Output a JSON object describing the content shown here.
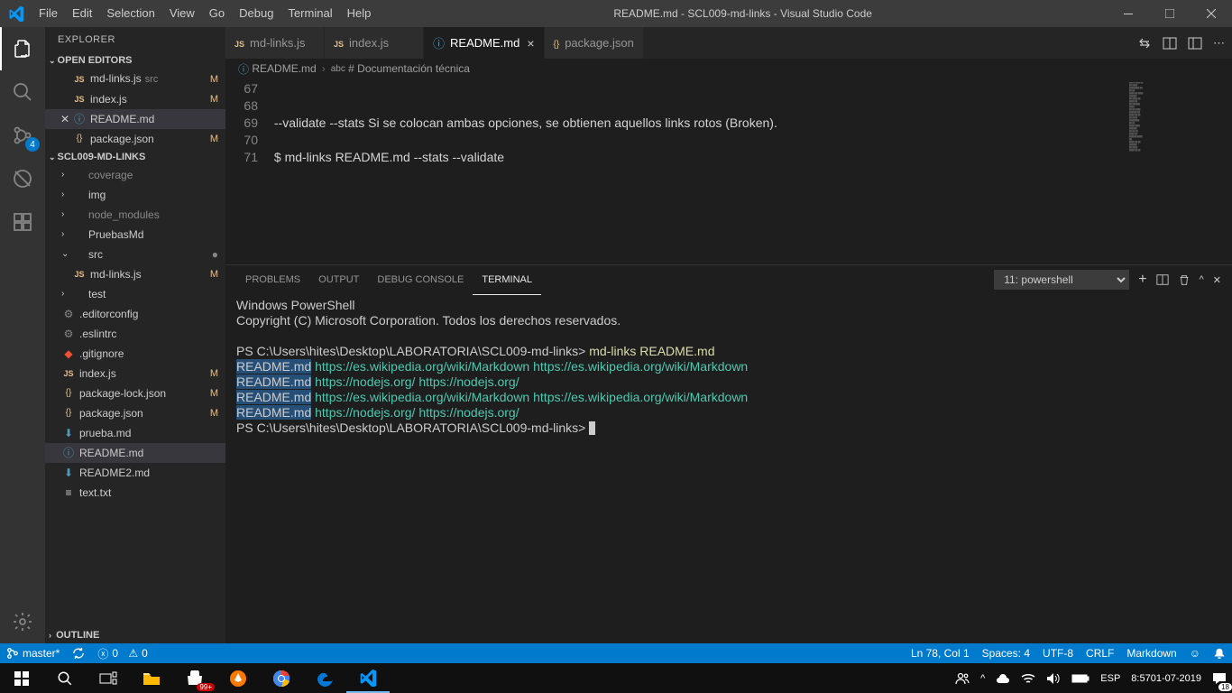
{
  "window": {
    "title": "README.md - SCL009-md-links - Visual Studio Code"
  },
  "menu": {
    "file": "File",
    "edit": "Edit",
    "selection": "Selection",
    "view": "View",
    "go": "Go",
    "debug": "Debug",
    "terminal": "Terminal",
    "help": "Help"
  },
  "activity": {
    "scm_badge": "4"
  },
  "sidebar": {
    "title": "EXPLORER",
    "sections": {
      "open_editors": "OPEN EDITORS",
      "workspace": "SCL009-MD-LINKS",
      "outline": "OUTLINE"
    },
    "open_editors": [
      {
        "icon": "js",
        "label": "md-links.js",
        "dim": "src",
        "badge": "M"
      },
      {
        "icon": "js",
        "label": "index.js",
        "dim": "",
        "badge": "M"
      },
      {
        "icon": "info",
        "label": "README.md",
        "dim": "",
        "badge": "",
        "active": true
      },
      {
        "icon": "json",
        "label": "package.json",
        "dim": "",
        "badge": "M"
      }
    ],
    "tree": [
      {
        "indent": 1,
        "chev": "›",
        "icon": "",
        "label": "coverage",
        "dim": true
      },
      {
        "indent": 1,
        "chev": "›",
        "icon": "",
        "label": "img"
      },
      {
        "indent": 1,
        "chev": "›",
        "icon": "",
        "label": "node_modules",
        "dim": true
      },
      {
        "indent": 1,
        "chev": "›",
        "icon": "",
        "label": "PruebasMd"
      },
      {
        "indent": 1,
        "chev": "⌄",
        "icon": "",
        "label": "src",
        "dot": true
      },
      {
        "indent": 2,
        "icon": "js",
        "label": "md-links.js",
        "badge": "M"
      },
      {
        "indent": 1,
        "chev": "›",
        "icon": "",
        "label": "test"
      },
      {
        "indent": 1,
        "icon": "gear",
        "label": ".editorconfig"
      },
      {
        "indent": 1,
        "icon": "gear",
        "label": ".eslintrc"
      },
      {
        "indent": 1,
        "icon": "git",
        "label": ".gitignore"
      },
      {
        "indent": 1,
        "icon": "js",
        "label": "index.js",
        "badge": "M"
      },
      {
        "indent": 1,
        "icon": "json",
        "label": "package-lock.json",
        "badge": "M"
      },
      {
        "indent": 1,
        "icon": "json",
        "label": "package.json",
        "badge": "M"
      },
      {
        "indent": 1,
        "icon": "md",
        "label": "prueba.md"
      },
      {
        "indent": 1,
        "icon": "info",
        "label": "README.md",
        "selected": true
      },
      {
        "indent": 1,
        "icon": "md",
        "label": "README2.md"
      },
      {
        "indent": 1,
        "icon": "txt",
        "label": "text.txt"
      }
    ]
  },
  "tabs": [
    {
      "icon": "js",
      "label": "md-links.js"
    },
    {
      "icon": "js",
      "label": "index.js"
    },
    {
      "icon": "info",
      "label": "README.md",
      "active": true,
      "close": true
    },
    {
      "icon": "json",
      "label": "package.json"
    }
  ],
  "breadcrumb": {
    "file": "README.md",
    "symbol": "# Documentación técnica",
    "abc": "abc"
  },
  "editor": {
    "lines": [
      {
        "num": "67",
        "text": ""
      },
      {
        "num": "68",
        "text": ""
      },
      {
        "num": "69",
        "text": " --validate --stats Si se colocan ambas opciones, se obtienen aquellos links rotos (Broken)."
      },
      {
        "num": "70",
        "text": ""
      },
      {
        "num": "71",
        "text": " $ md-links README.md --stats --validate"
      }
    ]
  },
  "panel": {
    "tabs": {
      "problems": "PROBLEMS",
      "output": "OUTPUT",
      "debug_console": "DEBUG CONSOLE",
      "terminal": "TERMINAL"
    },
    "selector": "11: powershell",
    "terminal": {
      "l1": "Windows PowerShell",
      "l2": "Copyright (C) Microsoft Corporation. Todos los derechos reservados.",
      "l3": "",
      "l4_prompt": "PS C:\\Users\\hites\\Desktop\\LABORATORIA\\SCL009-md-links> ",
      "l4_cmd": "md-links README.md",
      "rows": [
        {
          "file": "README.md",
          "u1": "https://es.wikipedia.org/wiki/Markdown",
          "u2": "https://es.wikipedia.org/wiki/Markdown"
        },
        {
          "file": "README.md",
          "u1": "https://nodejs.org/",
          "u2": "https://nodejs.org/"
        },
        {
          "file": "README.md",
          "u1": "https://es.wikipedia.org/wiki/Markdown",
          "u2": "https://es.wikipedia.org/wiki/Markdown"
        },
        {
          "file": "README.md",
          "u1": "https://nodejs.org/",
          "u2": "https://nodejs.org/"
        }
      ],
      "l_last": "PS C:\\Users\\hites\\Desktop\\LABORATORIA\\SCL009-md-links> "
    }
  },
  "status": {
    "branch": "master*",
    "errors": "0",
    "warnings": "0",
    "ln_col": "Ln 78, Col 1",
    "spaces": "Spaces: 4",
    "encoding": "UTF-8",
    "eol": "CRLF",
    "lang": "Markdown"
  },
  "taskbar": {
    "store_badge": "99+",
    "lang": "ESP",
    "time": "8:57",
    "date": "01-07-2019",
    "notif": "18"
  }
}
